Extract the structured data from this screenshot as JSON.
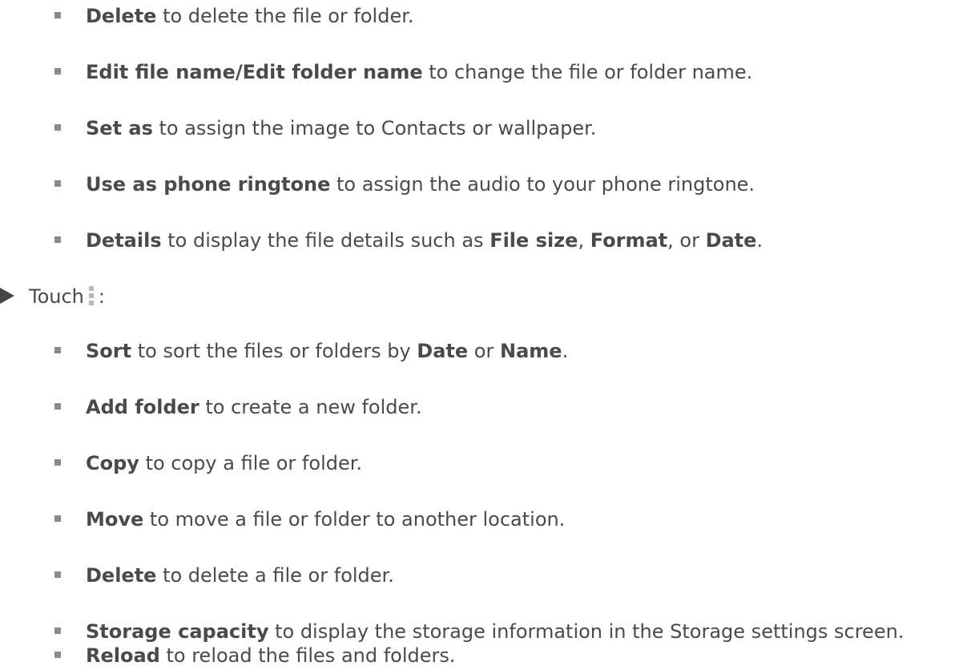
{
  "items_top": [
    {
      "term": "Delete",
      "rest": " to delete the file or folder."
    },
    {
      "term": "Edit file name/Edit folder name",
      "rest": " to change the file or folder name."
    },
    {
      "term": "Set as",
      "rest": " to assign the image to Contacts or wallpaper."
    },
    {
      "term": "Use as phone ringtone",
      "rest": " to assign the audio to your phone ringtone."
    },
    {
      "term": "Details",
      "rest": " to display the file details such as ",
      "term2": "File size",
      "sep1": ", ",
      "term3": "Format",
      "sep2": ", or ",
      "term4": "Date",
      "end": "."
    }
  ],
  "touch_row": {
    "prefix": "Touch",
    "suffix": ":"
  },
  "items_bottom": [
    {
      "term": "Sort",
      "rest": " to sort the files or folders by ",
      "term2": "Date",
      "sep": " or ",
      "term3": "Name",
      "end": "."
    },
    {
      "term": "Add folder",
      "rest": " to create a new folder."
    },
    {
      "term": "Copy",
      "rest": " to copy a file or folder."
    },
    {
      "term": "Move",
      "rest": " to move a file or folder to another location."
    },
    {
      "term": "Delete",
      "rest": " to delete a file or folder."
    },
    {
      "term": "Storage capacity",
      "rest": " to display the storage information in the Storage settings screen."
    },
    {
      "term": "Reload",
      "rest": " to reload the files and folders."
    }
  ],
  "icons": {
    "triangle": "triangle-right",
    "more": "vertical-dots-menu",
    "bullet": "square-bullet"
  }
}
